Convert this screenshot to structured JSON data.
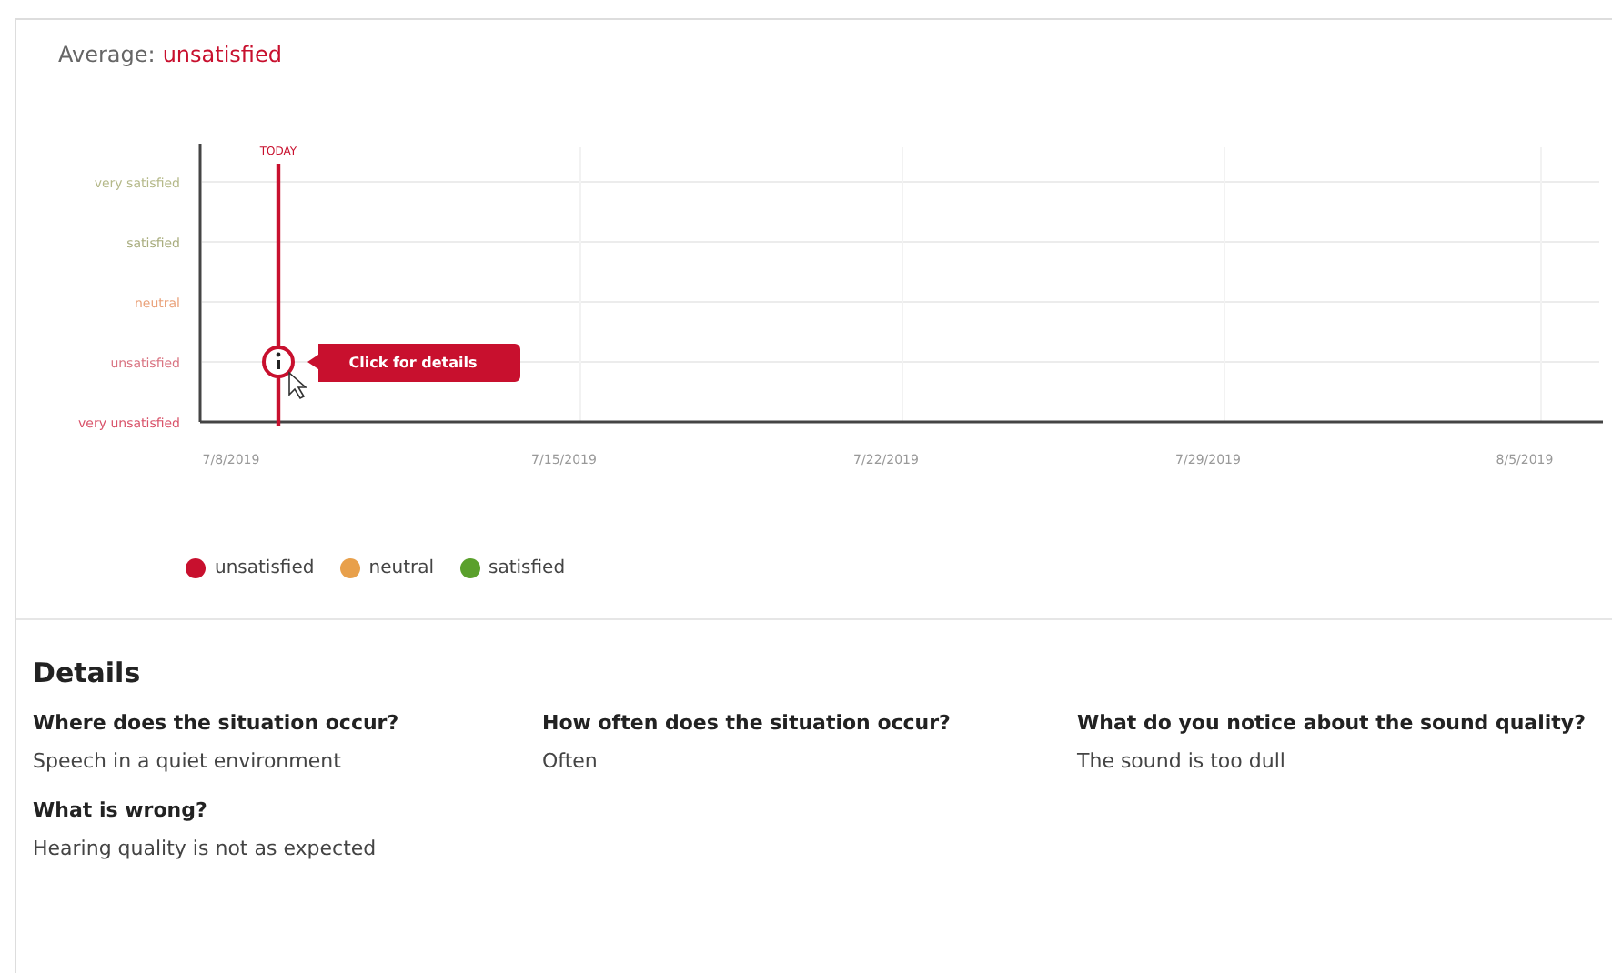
{
  "average": {
    "label": "Average:",
    "value": "unsatisfied"
  },
  "chart": {
    "today_label": "TODAY",
    "callout": "Click for details",
    "y_levels": [
      {
        "label": "very satisfied",
        "color": "#b5b98a",
        "marked": false
      },
      {
        "label": "satisfied",
        "color": "#a9ad7f",
        "marked": false
      },
      {
        "label": "neutral",
        "color": "#eaa27a",
        "marked": false
      },
      {
        "label": "unsatisfied",
        "color": "#d97482",
        "marked": true
      },
      {
        "label": "very unsatisfied",
        "color": "#d9536a",
        "marked": false
      }
    ],
    "x_labels": [
      "7/8/2019",
      "7/15/2019",
      "7/22/2019",
      "7/29/2019",
      "8/5/2019"
    ]
  },
  "legend": [
    {
      "label": "unsatisfied",
      "color": "#c8102e"
    },
    {
      "label": "neutral",
      "color": "#e8a04b"
    },
    {
      "label": "satisfied",
      "color": "#5aa02c"
    }
  ],
  "details": {
    "title": "Details",
    "items": [
      {
        "question": "Where does the situation occur?",
        "answer": "Speech in a quiet environment"
      },
      {
        "question": "How often does the situation occur?",
        "answer": "Often"
      },
      {
        "question": "What do you notice about the sound quality?",
        "answer": "The sound is too dull"
      },
      {
        "question": "What is wrong?",
        "answer": "Hearing quality is not as expected"
      }
    ]
  }
}
